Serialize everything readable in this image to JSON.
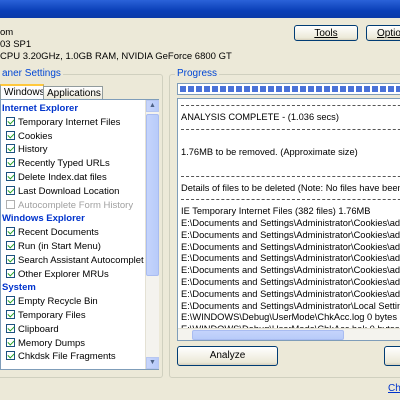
{
  "window": {
    "title_bar_color": "#0a3fb7"
  },
  "system_info": {
    "line1": "om",
    "line2": "03 SP1",
    "line3": "CPU 3.20GHz, 1.0GB RAM, NVIDIA GeForce 6800 GT"
  },
  "toolbar": {
    "tools_label": "Tools",
    "options_label": "Optio"
  },
  "left_panel": {
    "group_title": "aner Settings",
    "tabs": [
      {
        "label": "Windows",
        "active": true
      },
      {
        "label": "Applications",
        "active": false
      }
    ],
    "tree": [
      {
        "type": "section",
        "label": "Internet Explorer"
      },
      {
        "type": "item",
        "label": "Temporary Internet Files",
        "checked": true
      },
      {
        "type": "item",
        "label": "Cookies",
        "checked": true
      },
      {
        "type": "item",
        "label": "History",
        "checked": true
      },
      {
        "type": "item",
        "label": "Recently Typed URLs",
        "checked": true
      },
      {
        "type": "item",
        "label": "Delete Index.dat files",
        "checked": true
      },
      {
        "type": "item",
        "label": "Last Download Location",
        "checked": true
      },
      {
        "type": "item",
        "label": "Autocomplete Form History",
        "checked": false,
        "disabled": true
      },
      {
        "type": "section",
        "label": "Windows Explorer"
      },
      {
        "type": "item",
        "label": "Recent Documents",
        "checked": true
      },
      {
        "type": "item",
        "label": "Run (in Start Menu)",
        "checked": true
      },
      {
        "type": "item",
        "label": "Search Assistant Autocomplete",
        "checked": true
      },
      {
        "type": "item",
        "label": "Other Explorer MRUs",
        "checked": true
      },
      {
        "type": "section",
        "label": "System"
      },
      {
        "type": "item",
        "label": "Empty Recycle Bin",
        "checked": true
      },
      {
        "type": "item",
        "label": "Temporary Files",
        "checked": true
      },
      {
        "type": "item",
        "label": "Clipboard",
        "checked": true
      },
      {
        "type": "item",
        "label": "Memory Dumps",
        "checked": true
      },
      {
        "type": "item",
        "label": "Chkdsk File Fragments",
        "checked": true
      }
    ]
  },
  "progress": {
    "group_title": "Progress",
    "fill_fraction": 1.0,
    "log_lines": [
      {
        "kind": "sep"
      },
      {
        "kind": "text",
        "text": "ANALYSIS COMPLETE - (1.036 secs)"
      },
      {
        "kind": "sep"
      },
      {
        "kind": "blank"
      },
      {
        "kind": "text",
        "text": "1.76MB to be removed. (Approximate size)"
      },
      {
        "kind": "blank"
      },
      {
        "kind": "sep"
      },
      {
        "kind": "text",
        "text": "Details of files to be deleted (Note: No files have been dele"
      },
      {
        "kind": "sep"
      },
      {
        "kind": "text",
        "text": "IE Temporary Internet Files (382 files) 1.76MB"
      },
      {
        "kind": "text",
        "text": "E:\\Documents and Settings\\Administrator\\Cookies\\admi"
      },
      {
        "kind": "text",
        "text": "E:\\Documents and Settings\\Administrator\\Cookies\\admi"
      },
      {
        "kind": "text",
        "text": "E:\\Documents and Settings\\Administrator\\Cookies\\admi"
      },
      {
        "kind": "text",
        "text": "E:\\Documents and Settings\\Administrator\\Cookies\\admi"
      },
      {
        "kind": "text",
        "text": "E:\\Documents and Settings\\Administrator\\Cookies\\admi"
      },
      {
        "kind": "text",
        "text": "E:\\Documents and Settings\\Administrator\\Cookies\\admi"
      },
      {
        "kind": "text",
        "text": "E:\\Documents and Settings\\Administrator\\Cookies\\admi"
      },
      {
        "kind": "text",
        "text": "E:\\Documents and Settings\\Administrator\\Local Settings\\"
      },
      {
        "kind": "text",
        "text": "E:\\WINDOWS\\Debug\\UserMode\\ChkAcc.log 0 bytes"
      },
      {
        "kind": "text",
        "text": "E:\\WINDOWS\\Debug\\UserMode\\ChkAcc.bak 0 bytes"
      },
      {
        "kind": "text",
        "text": "E:\\Documents and Settings\\Administrator\\Application Da"
      },
      {
        "kind": "blank"
      },
      {
        "kind": "sep"
      }
    ]
  },
  "buttons": {
    "analyze_label": "Analyze",
    "run_label": ""
  },
  "footer": {
    "link_label": "Ch"
  }
}
